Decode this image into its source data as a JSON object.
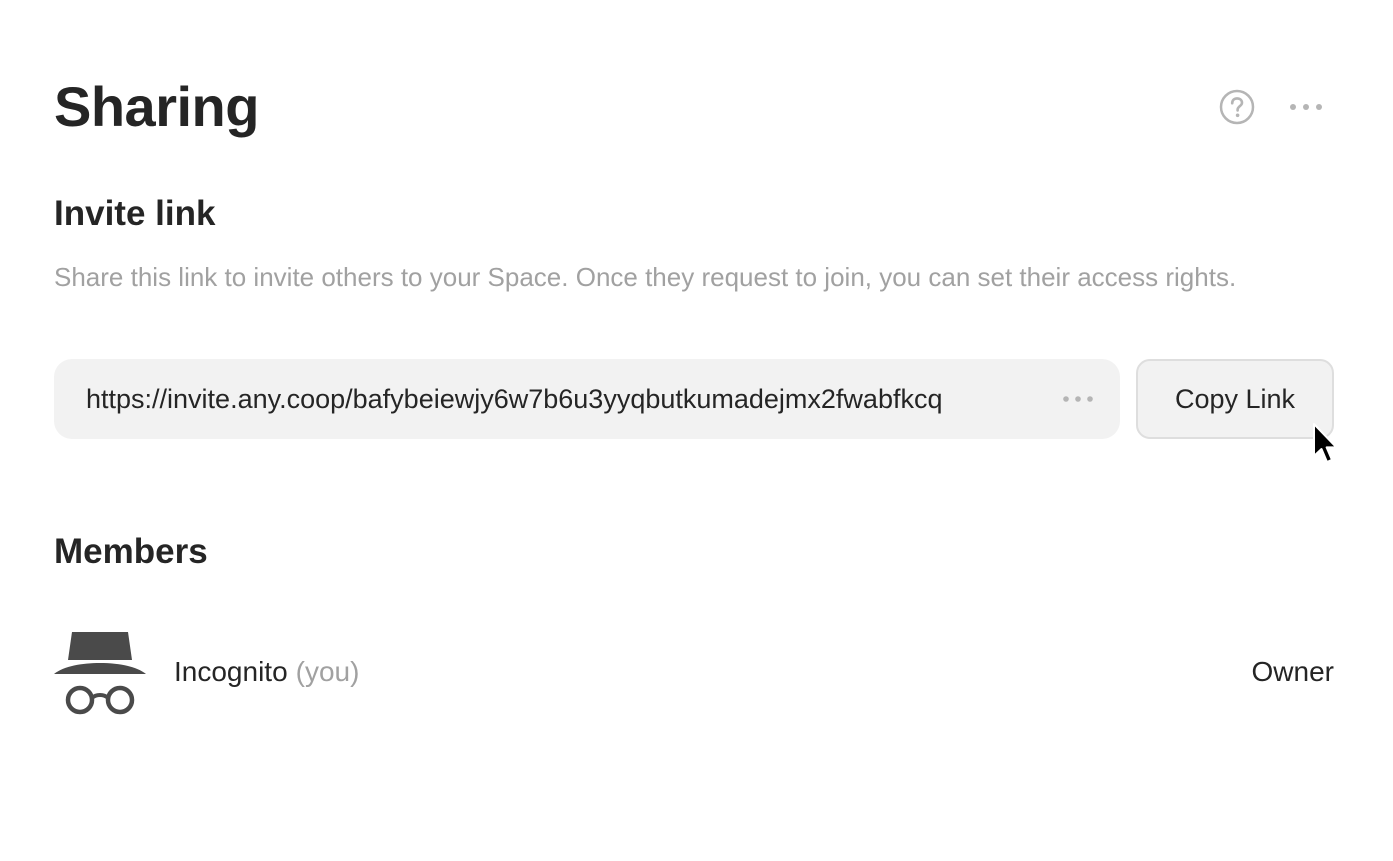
{
  "header": {
    "title": "Sharing",
    "help_icon": "question-circle-icon",
    "more_icon": "ellipsis-horizontal-icon"
  },
  "invite": {
    "heading": "Invite link",
    "description": "Share this link to invite others to your Space. Once they request to join, you can set their access rights.",
    "link_value": "https://invite.any.coop/bafybeiewjy6w7b6u3yyqbutkumadejmx2fwabfkcq",
    "link_more_icon": "ellipsis-horizontal-icon",
    "copy_label": "Copy Link"
  },
  "members": {
    "heading": "Members",
    "items": [
      {
        "name": "Incognito",
        "suffix": "(you)",
        "role": "Owner",
        "avatar_icon": "incognito-icon"
      }
    ]
  },
  "colors": {
    "text": "#252525",
    "muted": "#a1a1a1",
    "field_bg": "#f2f2f2",
    "button_border": "#dedede",
    "icon": "#b5b5b5"
  }
}
